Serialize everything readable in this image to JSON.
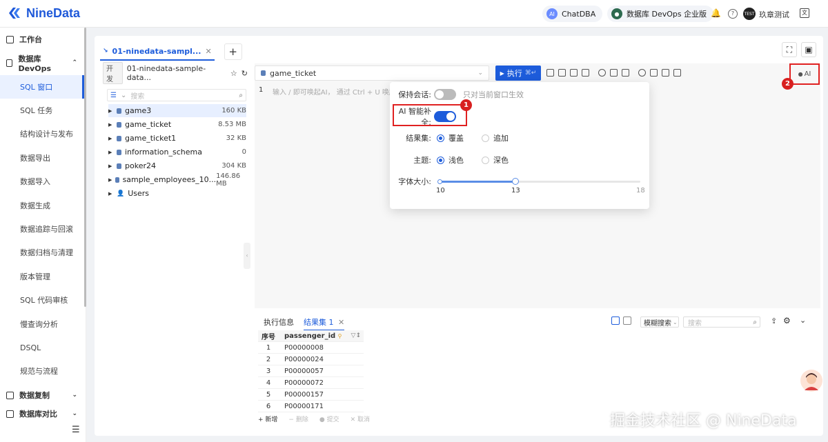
{
  "app": {
    "logo_text": "NineData",
    "brand_color": "#1f59d9"
  },
  "header": {
    "chatdba": "ChatDBA",
    "edition": "数据库 DevOps 企业版",
    "user": "玖章测试",
    "user_avatar_text": "TEST"
  },
  "sidebar": {
    "items": [
      {
        "label": "工作台",
        "type": "group",
        "icon": "home-icon"
      },
      {
        "label": "数据库 DevOps",
        "type": "group",
        "icon": "devops-icon",
        "expanded": true
      },
      {
        "label": "SQL 窗口",
        "type": "sub",
        "active": true
      },
      {
        "label": "SQL 任务",
        "type": "sub"
      },
      {
        "label": "结构设计与发布",
        "type": "sub"
      },
      {
        "label": "数据导出",
        "type": "sub"
      },
      {
        "label": "数据导入",
        "type": "sub"
      },
      {
        "label": "数据生成",
        "type": "sub"
      },
      {
        "label": "数据追踪与回滚",
        "type": "sub"
      },
      {
        "label": "数据归档与清理",
        "type": "sub"
      },
      {
        "label": "版本管理",
        "type": "sub"
      },
      {
        "label": "SQL 代码审核",
        "type": "sub"
      },
      {
        "label": "慢查询分析",
        "type": "sub"
      },
      {
        "label": "DSQL",
        "type": "sub"
      },
      {
        "label": "规范与流程",
        "type": "sub"
      },
      {
        "label": "数据复制",
        "type": "group",
        "icon": "replication-icon"
      },
      {
        "label": "数据库对比",
        "type": "group",
        "icon": "compare-icon"
      }
    ]
  },
  "tabs": [
    {
      "label": "01-ninedata-sampl..."
    }
  ],
  "db_panel": {
    "env": "开发",
    "datasource": "01-ninedata-sample-data...",
    "search_placeholder": "搜索",
    "tree": [
      {
        "name": "game3",
        "size": "160 KB",
        "selected": true
      },
      {
        "name": "game_ticket",
        "size": "8.53 MB"
      },
      {
        "name": "game_ticket1",
        "size": "32 KB"
      },
      {
        "name": "information_schema",
        "size": "0"
      },
      {
        "name": "poker24",
        "size": "304 KB"
      },
      {
        "name": "sample_employees_10...",
        "size": "146.86 MB"
      },
      {
        "name": "Users",
        "size": ""
      }
    ]
  },
  "editor": {
    "database": "game_ticket",
    "run_label": "执行",
    "run_shortcut": "⌘↵",
    "ai_label": "AI",
    "line_number": "1",
    "hint": "输入 / 即可唤起AI， 通过 Ctrl + U 唤起"
  },
  "settings_popup": {
    "keep_session_label": "保持会话:",
    "keep_session_on": false,
    "keep_session_note": "只对当前窗口生效",
    "ai_complete_label": "AI 智能补全:",
    "ai_complete_on": true,
    "result_label": "结果集:",
    "result_options": [
      "覆盖",
      "追加"
    ],
    "result_selected": 0,
    "theme_label": "主题:",
    "theme_options": [
      "浅色",
      "深色"
    ],
    "theme_selected": 0,
    "font_label": "字体大小:",
    "font_min": 10,
    "font_value": 13,
    "font_max": 18
  },
  "annotations": {
    "badge1": "1",
    "badge2": "2",
    "highlight_color": "#e02020"
  },
  "results": {
    "tabs": [
      {
        "label": "执行信息"
      },
      {
        "label": "结果集 1",
        "active": true
      }
    ],
    "fuzzy_search": "模糊搜索",
    "search_placeholder": "搜索",
    "columns": [
      "序号",
      "passenger_id"
    ],
    "rows": [
      [
        "1",
        "P00000008"
      ],
      [
        "2",
        "P00000024"
      ],
      [
        "3",
        "P00000057"
      ],
      [
        "4",
        "P00000072"
      ],
      [
        "5",
        "P00000157"
      ],
      [
        "6",
        "P00000171"
      ]
    ],
    "bottom_actions": [
      "新增",
      "删除",
      "提交",
      "取消"
    ]
  },
  "watermark": "掘金技术社区 @ NineData"
}
